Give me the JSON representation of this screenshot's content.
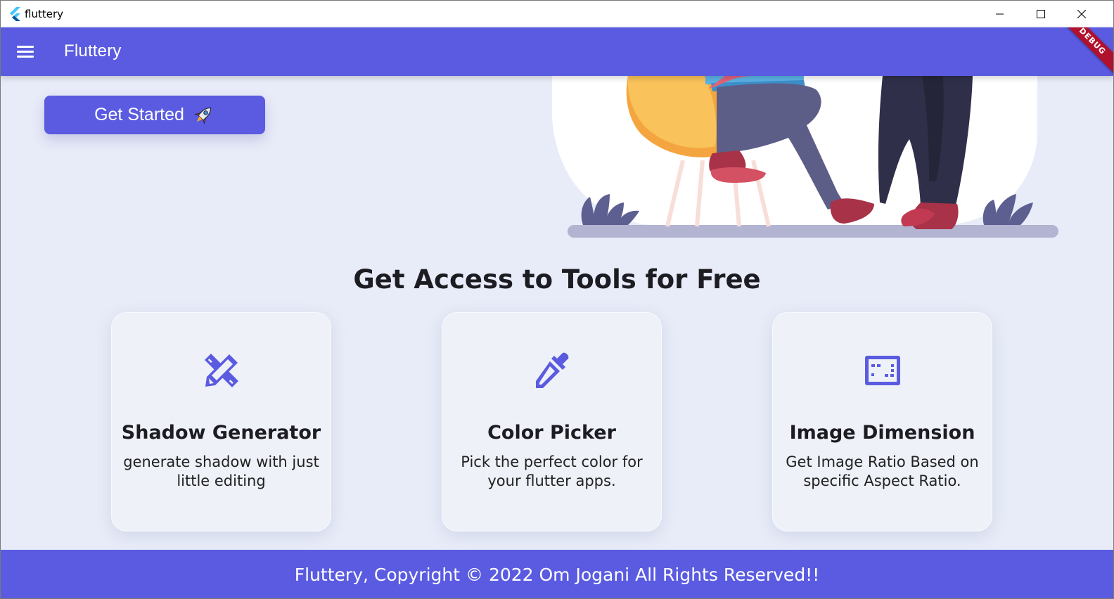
{
  "window": {
    "title": "fluttery",
    "icon": "flutter-logo-icon"
  },
  "appbar": {
    "title": "Fluttery",
    "menu_icon": "hamburger-menu-icon",
    "debug_label": "DEBUG",
    "background": "#5a5be0"
  },
  "hero": {
    "button_label": "Get Started",
    "button_icon": "rocket-icon"
  },
  "tools": {
    "heading": "Get Access to Tools for Free",
    "cards": [
      {
        "title": "Shadow Generator",
        "description": "generate shadow with just little editing",
        "icon": "design-services-icon"
      },
      {
        "title": "Color Picker",
        "description": "Pick the perfect color for your flutter apps.",
        "icon": "eyedropper-icon"
      },
      {
        "title": "Image Dimension",
        "description": "Get Image Ratio Based on specific Aspect Ratio.",
        "icon": "aspect-ratio-icon"
      }
    ]
  },
  "footer": {
    "text": "Fluttery, Copyright © 2022 Om Jogani All Rights Reserved!!"
  },
  "colors": {
    "primary": "#5a5be0",
    "background": "#e8ecf8",
    "card": "#eef1f8",
    "debug": "#b0112d"
  }
}
